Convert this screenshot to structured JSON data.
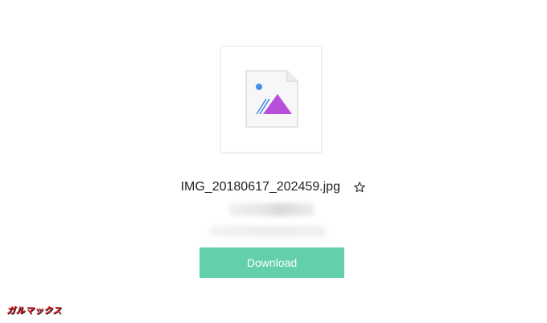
{
  "file": {
    "name": "IMG_20180617_202459.jpg",
    "thumbnail_icon": "image-file-icon",
    "favorite_icon": "star-outline-icon"
  },
  "actions": {
    "download_label": "Download"
  },
  "watermark": {
    "text": "ガルマックス"
  },
  "colors": {
    "accent": "#63cfad",
    "icon_triangle": "#b84fdc",
    "icon_dot": "#4a8fe8"
  }
}
